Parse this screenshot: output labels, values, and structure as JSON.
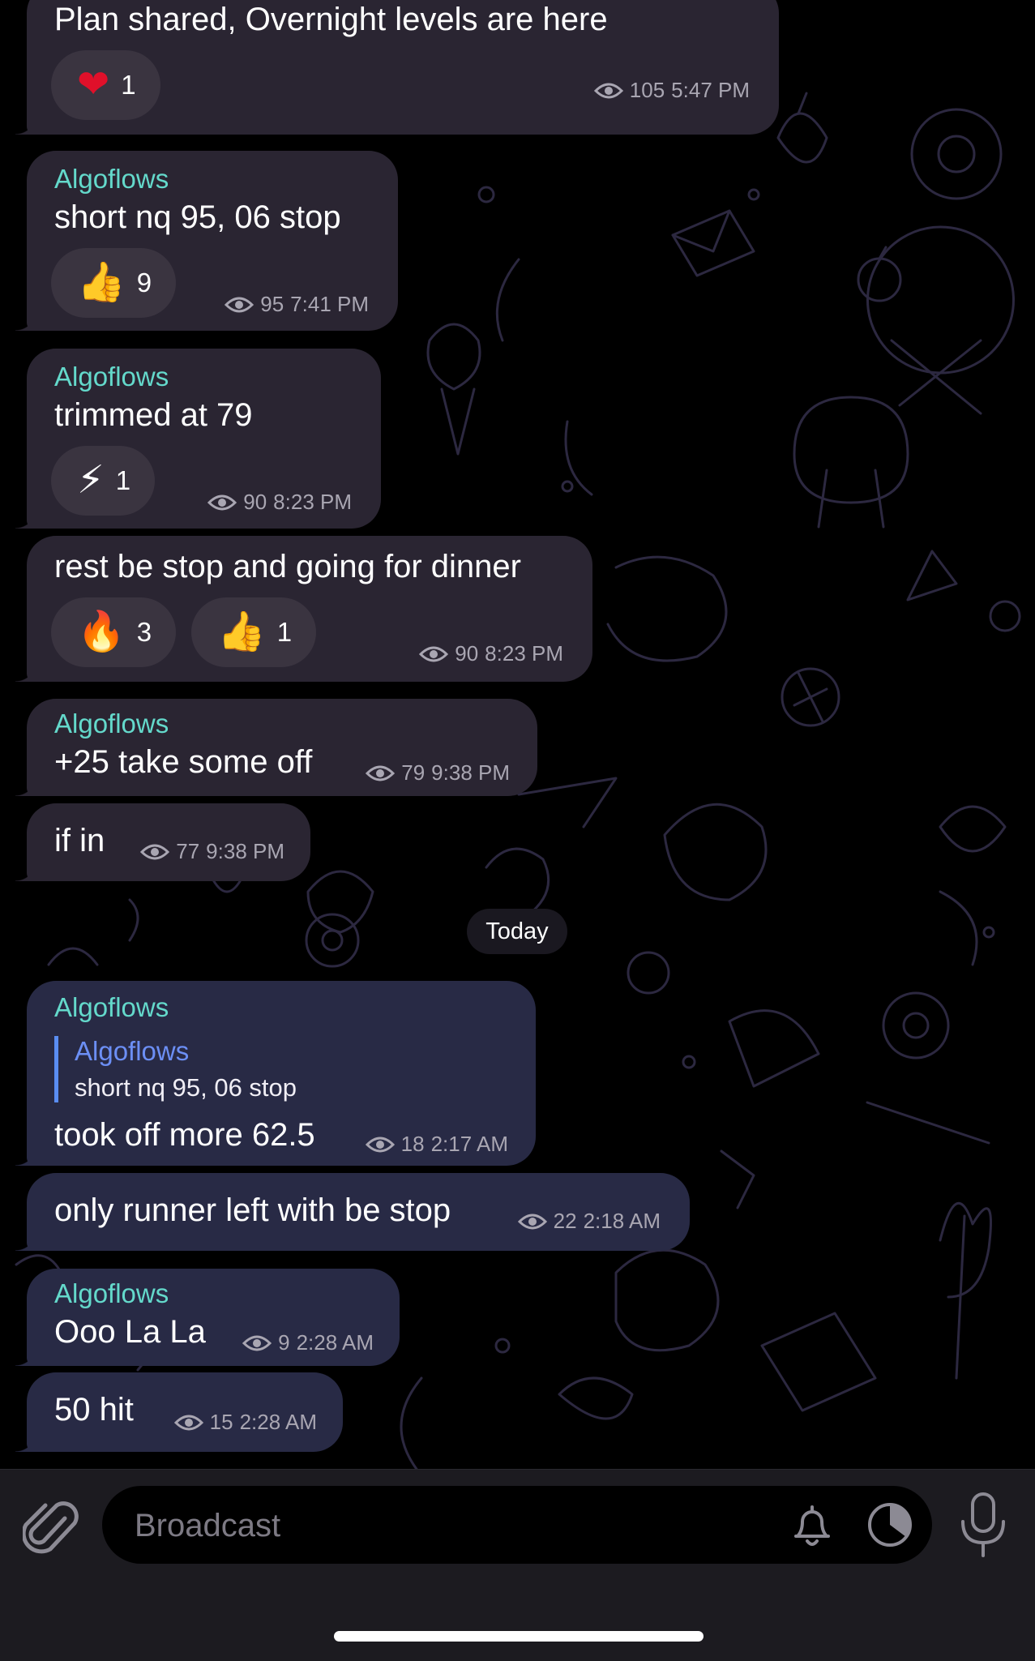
{
  "colors": {
    "background": "#000000",
    "bubble": "#2a2532",
    "bubble_selected": "#282a45",
    "sender_name": "#64d9cb",
    "quote_accent": "#5a8df2",
    "meta_text": "#a9a6b2",
    "composer_bg": "#1c1b20"
  },
  "messages": [
    {
      "text": "Plan shared, Overnight levels are here",
      "reactions": [
        {
          "icon": "heart-icon",
          "emoji": "❤️",
          "count": "1"
        }
      ],
      "views": "105",
      "time": "5:47 PM"
    },
    {
      "sender": "Algoflows",
      "text": "short nq 95, 06 stop",
      "reactions": [
        {
          "icon": "thumbs-up-icon",
          "emoji": "👍",
          "count": "9"
        }
      ],
      "views": "95",
      "time": "7:41 PM"
    },
    {
      "sender": "Algoflows",
      "text": "trimmed at 79",
      "reactions": [
        {
          "icon": "lightning-icon",
          "emoji": "⚡",
          "count": "1"
        }
      ],
      "views": "90",
      "time": "8:23 PM"
    },
    {
      "text": "rest be stop and going for dinner",
      "reactions": [
        {
          "icon": "fire-icon",
          "emoji": "🔥",
          "count": "3"
        },
        {
          "icon": "thumbs-up-icon",
          "emoji": "👍",
          "count": "1"
        }
      ],
      "views": "90",
      "time": "8:23 PM"
    },
    {
      "sender": "Algoflows",
      "text": "+25 take some off",
      "views": "79",
      "time": "9:38 PM"
    },
    {
      "text": "if in",
      "views": "77",
      "time": "9:38 PM"
    },
    {
      "sender": "Algoflows",
      "reply": {
        "sender": "Algoflows",
        "text": "short nq 95, 06 stop"
      },
      "text": "took off more 62.5",
      "views": "18",
      "time": "2:17 AM"
    },
    {
      "text": "only runner left with be stop",
      "views": "22",
      "time": "2:18 AM"
    },
    {
      "sender": "Algoflows",
      "text": "Ooo La La",
      "views": "9",
      "time": "2:28 AM"
    },
    {
      "text": "50 hit",
      "views": "15",
      "time": "2:28 AM"
    }
  ],
  "date_separator": "Today",
  "composer": {
    "placeholder": "Broadcast",
    "attach_icon": "paperclip-icon",
    "notification_icon": "bell-icon",
    "schedule_icon": "timer-icon",
    "voice_icon": "microphone-icon"
  }
}
